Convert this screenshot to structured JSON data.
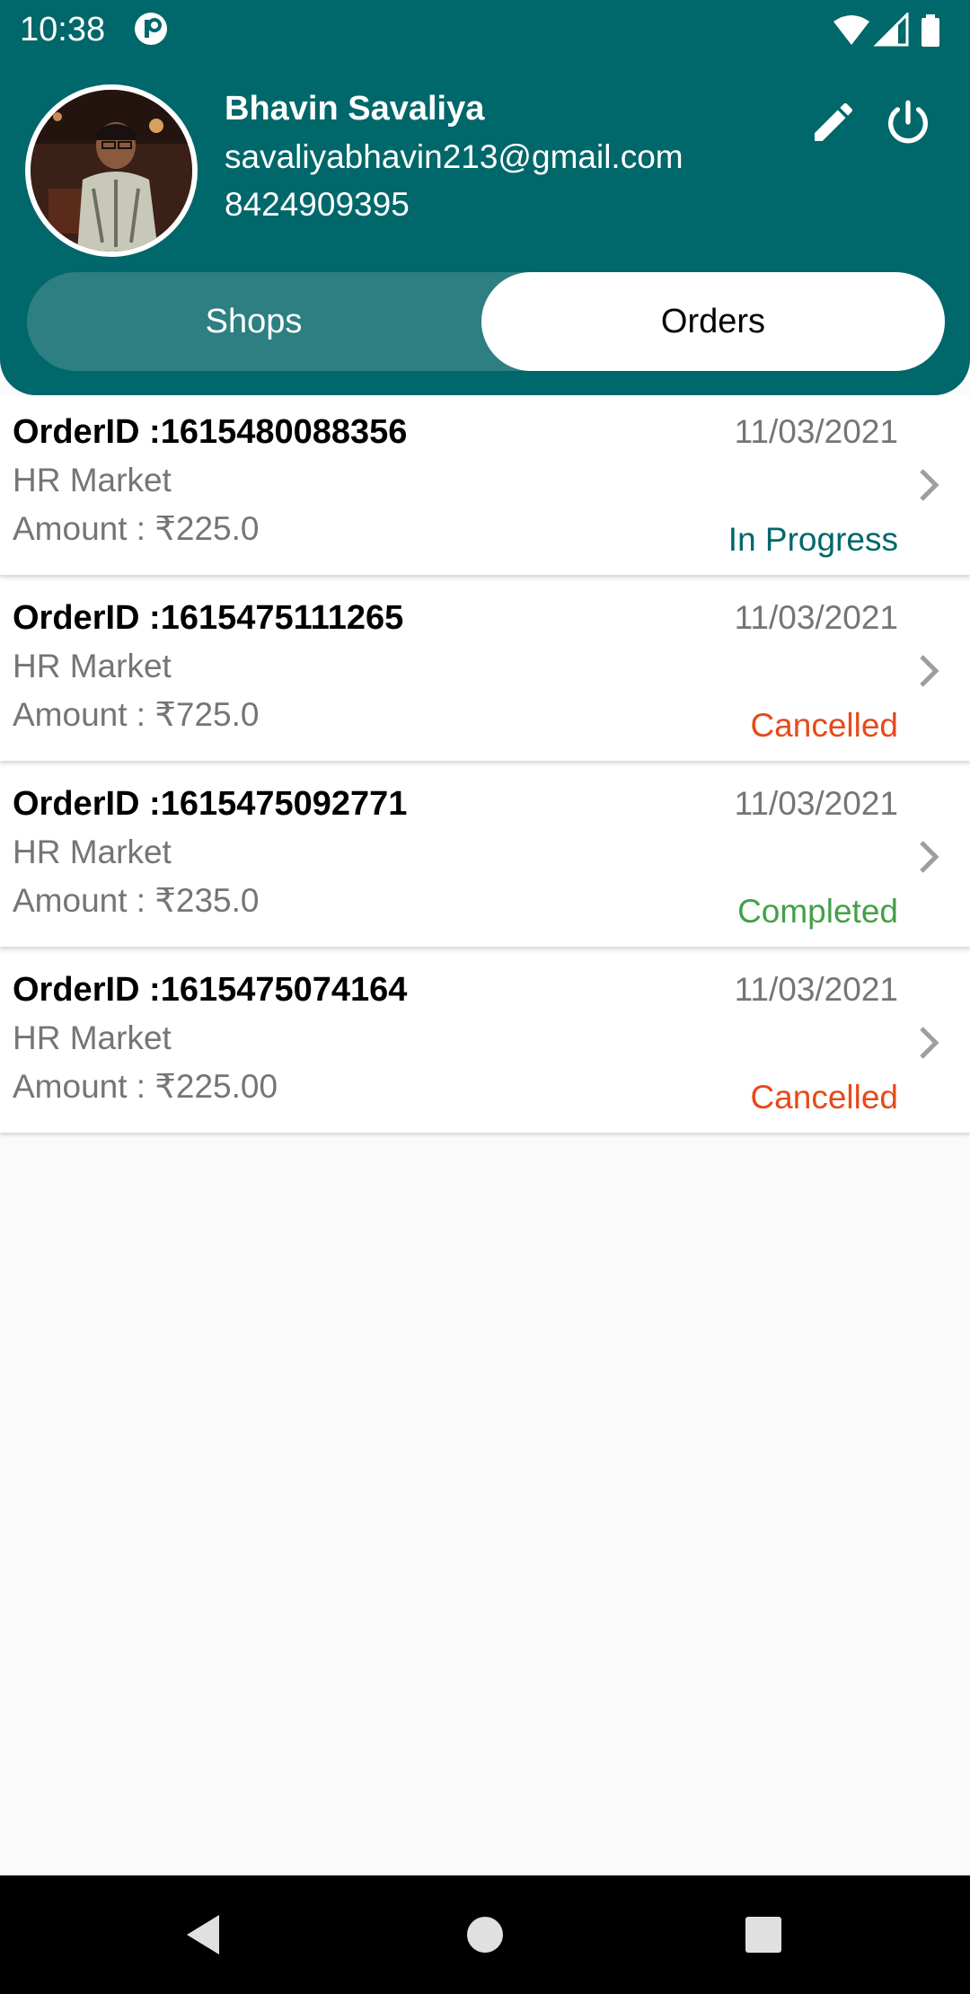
{
  "status_bar": {
    "time": "10:38",
    "icons": [
      "app-notification-icon",
      "wifi-icon",
      "signal-icon",
      "battery-icon"
    ]
  },
  "profile": {
    "name": "Bhavin Savaliya",
    "email": "savaliyabhavin213@gmail.com",
    "phone": "8424909395",
    "avatar": "profile-photo",
    "actions": [
      "edit-icon",
      "power-icon"
    ]
  },
  "tabs": {
    "shops_label": "Shops",
    "orders_label": "Orders",
    "selected": "Orders"
  },
  "orders": [
    {
      "id": "OrderID :1615480088356",
      "date": "11/03/2021",
      "shop": "HR Market",
      "amount": "Amount : ₹225.0",
      "status": "In Progress"
    },
    {
      "id": "OrderID :1615475111265",
      "date": "11/03/2021",
      "shop": "HR Market",
      "amount": "Amount : ₹725.0",
      "status": "Cancelled"
    },
    {
      "id": "OrderID :1615475092771",
      "date": "11/03/2021",
      "shop": "HR Market",
      "amount": "Amount : ₹235.0",
      "status": "Completed"
    },
    {
      "id": "OrderID :1615475074164",
      "date": "11/03/2021",
      "shop": "HR Market",
      "amount": "Amount : ₹225.00",
      "status": "Cancelled"
    }
  ],
  "status_colors": {
    "In Progress": "#00676a",
    "Cancelled": "#e64a19",
    "Completed": "#43a047"
  },
  "theme": {
    "primary": "#00676a",
    "segment_bg": "#2d7f81",
    "background": "#fafafa",
    "secondary_text": "#757575"
  },
  "nav": {
    "icons": [
      "back-icon",
      "home-icon",
      "recents-icon"
    ]
  }
}
